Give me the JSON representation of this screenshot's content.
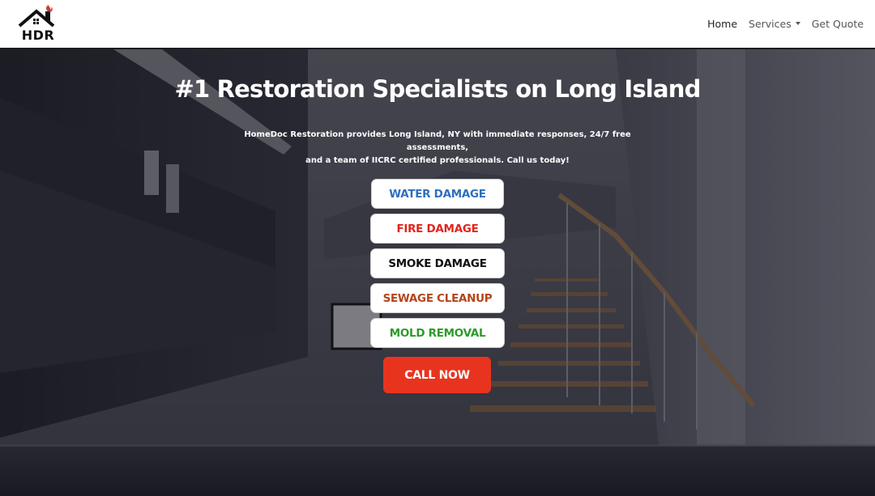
{
  "brand": {
    "logo_text": "HDR"
  },
  "nav": {
    "items": [
      {
        "label": "Home",
        "active": true
      },
      {
        "label": "Services",
        "dropdown": true
      },
      {
        "label": "Get Quote"
      }
    ]
  },
  "hero": {
    "title": "#1 Restoration Specialists on Long Island",
    "subtitle_line1": "HomeDoc Restoration provides Long Island, NY with immediate responses, 24/7 free assessments,",
    "subtitle_line2": "and a team of IICRC certified professionals. Call us today!"
  },
  "services": [
    {
      "label": "WATER DAMAGE",
      "color": "#2e6fbf"
    },
    {
      "label": "FIRE DAMAGE",
      "color": "#e0261c"
    },
    {
      "label": "SMOKE DAMAGE",
      "color": "#111111"
    },
    {
      "label": "SEWAGE CLEANUP",
      "color": "#b5451b"
    },
    {
      "label": "MOLD REMOVAL",
      "color": "#2c9a2c"
    }
  ],
  "cta": {
    "label": "CALL NOW",
    "color": "#e8341f"
  },
  "icons": {
    "logo": "house-flame-logo-icon",
    "services_caret": "caret-down-icon"
  }
}
